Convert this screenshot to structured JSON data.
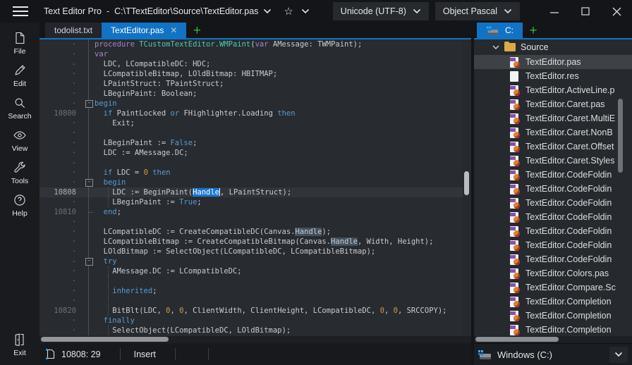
{
  "window": {
    "app_name": "Text Editor Pro",
    "title_separator": "-",
    "file_path": "C:\\TTextEditor\\Source\\TextEditor.pas",
    "encoding_selector": "Unicode (UTF-8)",
    "language_selector": "Object Pascal"
  },
  "glyphs": {
    "star": "☆",
    "close": "✕",
    "plus": "+"
  },
  "sidebar": {
    "items": [
      {
        "label": "File"
      },
      {
        "label": "Edit"
      },
      {
        "label": "Search"
      },
      {
        "label": "View"
      },
      {
        "label": "Tools"
      },
      {
        "label": "Help"
      }
    ],
    "exit_label": "Exit"
  },
  "editor_tabs": {
    "tabs": [
      {
        "label": "todolist.txt",
        "active": false
      },
      {
        "label": "TextEditor.pas",
        "active": true,
        "closable": true
      }
    ],
    "add_tab_label": "+"
  },
  "editor": {
    "accent_color": "#1273c4",
    "selection_color": "#1c74cf",
    "keyword_color": "#569cd6",
    "declaration_color": "#ab82c9",
    "method_color": "#4ec9b0",
    "number_color": "#cf9a4a",
    "lines": [
      {
        "n": "·",
        "t": [
          [
            "d",
            "procedure "
          ],
          [
            "m",
            "TCustomTextEditor.WMPaint"
          ],
          [
            "p",
            "("
          ],
          [
            "d",
            "var"
          ],
          [
            "p",
            " AMessage: TWMPaint);"
          ]
        ]
      },
      {
        "n": "·",
        "t": [
          [
            "d",
            "var"
          ]
        ]
      },
      {
        "n": "-",
        "t": [
          [
            "p",
            "  LDC, LCompatibleDC: HDC;"
          ]
        ]
      },
      {
        "n": "·",
        "t": [
          [
            "p",
            "  LCompatibleBitmap, LOldBitmap: HBITMAP;"
          ]
        ]
      },
      {
        "n": "·",
        "t": [
          [
            "p",
            "  LPaintStruct: TPaintStruct;"
          ]
        ]
      },
      {
        "n": "·",
        "t": [
          [
            "p",
            "  LBeginPaint: Boolean;"
          ]
        ]
      },
      {
        "n": "·",
        "f": "b",
        "t": [
          [
            "k",
            "begin"
          ]
        ]
      },
      {
        "n": "10800",
        "t": [
          [
            "p",
            "  "
          ],
          [
            "k",
            "if"
          ],
          [
            "p",
            " PaintLocked "
          ],
          [
            "k",
            "or"
          ],
          [
            "p",
            " FHighlighter.Loading "
          ],
          [
            "k",
            "then"
          ]
        ]
      },
      {
        "n": "·",
        "t": [
          [
            "p",
            "    Exit;"
          ]
        ]
      },
      {
        "n": "·",
        "t": []
      },
      {
        "n": "·",
        "t": [
          [
            "p",
            "  LBeginPaint := "
          ],
          [
            "k",
            "False"
          ],
          [
            "p",
            ";"
          ]
        ]
      },
      {
        "n": "·",
        "t": [
          [
            "p",
            "  LDC := AMessage.DC;"
          ]
        ]
      },
      {
        "n": "-",
        "t": []
      },
      {
        "n": "·",
        "t": [
          [
            "p",
            "  "
          ],
          [
            "k",
            "if"
          ],
          [
            "p",
            " LDC = "
          ],
          [
            "n",
            "0"
          ],
          [
            "p",
            " "
          ],
          [
            "k",
            "then"
          ]
        ]
      },
      {
        "n": "·",
        "f": "b",
        "t": [
          [
            "p",
            "  "
          ],
          [
            "k",
            "begin"
          ]
        ]
      },
      {
        "n": "10808",
        "a": true,
        "g": 3,
        "t": [
          [
            "p",
            "    LDC := BeginPaint("
          ],
          [
            "sel",
            "Handle"
          ],
          [
            "caret",
            ""
          ],
          [
            "p",
            ", LPaintStruct);"
          ]
        ]
      },
      {
        "n": "·",
        "g": 3,
        "t": [
          [
            "p",
            "    LBeginPaint := "
          ],
          [
            "k",
            "True"
          ],
          [
            "p",
            ";"
          ]
        ]
      },
      {
        "n": "10810",
        "f": "e",
        "t": [
          [
            "p",
            "  "
          ],
          [
            "k",
            "end"
          ],
          [
            "p",
            ";"
          ]
        ]
      },
      {
        "n": "·",
        "t": []
      },
      {
        "n": "·",
        "t": [
          [
            "p",
            "  LCompatibleDC := CreateCompatibleDC(Canvas."
          ],
          [
            "hl",
            "Handle"
          ],
          [
            "p",
            ");"
          ]
        ]
      },
      {
        "n": "·",
        "t": [
          [
            "p",
            "  LCompatibleBitmap := CreateCompatibleBitmap(Canvas."
          ],
          [
            "hl",
            "Handle"
          ],
          [
            "p",
            ", Width, Height);"
          ]
        ]
      },
      {
        "n": "·",
        "t": [
          [
            "p",
            "  LOldBitmap := SelectObject(LCompatibleDC, LCompatibleBitmap);"
          ]
        ]
      },
      {
        "n": "-",
        "f": "b",
        "t": [
          [
            "p",
            "  "
          ],
          [
            "k",
            "try"
          ]
        ]
      },
      {
        "n": "·",
        "g": 3,
        "t": [
          [
            "p",
            "    AMessage.DC := LCompatibleDC;"
          ]
        ]
      },
      {
        "n": "·",
        "g": 3,
        "t": []
      },
      {
        "n": "·",
        "g": 3,
        "t": [
          [
            "p",
            "    "
          ],
          [
            "k",
            "inherited"
          ],
          [
            "p",
            ";"
          ]
        ]
      },
      {
        "n": "·",
        "g": 3,
        "t": []
      },
      {
        "n": "10820",
        "g": 3,
        "t": [
          [
            "p",
            "    BitBlt(LDC, "
          ],
          [
            "n",
            "0"
          ],
          [
            "p",
            ", "
          ],
          [
            "n",
            "0"
          ],
          [
            "p",
            ", ClientWidth, ClientHeight, LCompatibleDC, "
          ],
          [
            "n",
            "0"
          ],
          [
            "p",
            ", "
          ],
          [
            "n",
            "0"
          ],
          [
            "p",
            ", SRCCOPY);"
          ]
        ]
      },
      {
        "n": "·",
        "t": [
          [
            "p",
            "  "
          ],
          [
            "k",
            "finally"
          ]
        ]
      },
      {
        "n": "·",
        "g": 3,
        "t": [
          [
            "p",
            "    SelectObject(LCompatibleDC, LOldBitmap);"
          ]
        ]
      }
    ]
  },
  "status_bar": {
    "caret_position": "10808: 29",
    "mode": "Insert"
  },
  "file_panel": {
    "tab_label": "C:",
    "add_tab_label": "+",
    "folder_name": "Source",
    "files": [
      {
        "name": "TextEditor.pas",
        "icon": "pas",
        "selected": true
      },
      {
        "name": "TextEditor.res",
        "icon": "res"
      },
      {
        "name": "TextEditor.ActiveLine.p",
        "icon": "pas"
      },
      {
        "name": "TextEditor.Caret.pas",
        "icon": "pas"
      },
      {
        "name": "TextEditor.Caret.MultiE",
        "icon": "pas"
      },
      {
        "name": "TextEditor.Caret.NonB",
        "icon": "pas"
      },
      {
        "name": "TextEditor.Caret.Offset",
        "icon": "pas"
      },
      {
        "name": "TextEditor.Caret.Styles",
        "icon": "pas"
      },
      {
        "name": "TextEditor.CodeFoldin",
        "icon": "pas"
      },
      {
        "name": "TextEditor.CodeFoldin",
        "icon": "pas"
      },
      {
        "name": "TextEditor.CodeFoldin",
        "icon": "pas"
      },
      {
        "name": "TextEditor.CodeFoldin",
        "icon": "pas"
      },
      {
        "name": "TextEditor.CodeFoldin",
        "icon": "pas"
      },
      {
        "name": "TextEditor.CodeFoldin",
        "icon": "pas"
      },
      {
        "name": "TextEditor.CodeFoldin",
        "icon": "pas"
      },
      {
        "name": "TextEditor.Colors.pas",
        "icon": "pas"
      },
      {
        "name": "TextEditor.Compare.Sc",
        "icon": "pas"
      },
      {
        "name": "TextEditor.Completion",
        "icon": "pas"
      },
      {
        "name": "TextEditor.Completion",
        "icon": "pas"
      },
      {
        "name": "TextEditor.Completion",
        "icon": "pas"
      }
    ],
    "drive_selector": "Windows (C:)"
  }
}
